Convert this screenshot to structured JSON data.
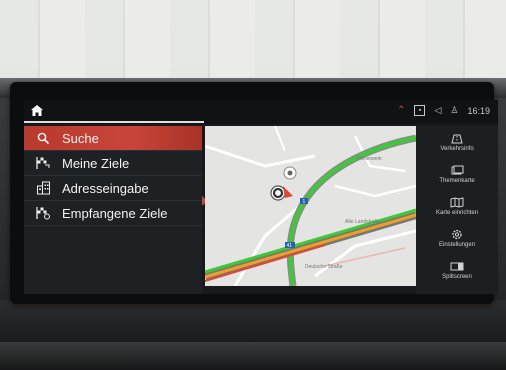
{
  "statusbar": {
    "time": "16:19",
    "icons": [
      "up-arrow-icon",
      "device-icon",
      "volume-icon",
      "person-icon"
    ]
  },
  "menu": {
    "items": [
      {
        "label": "Suche",
        "icon": "search-icon",
        "active": true
      },
      {
        "label": "Meine Ziele",
        "icon": "flag-icon",
        "active": false
      },
      {
        "label": "Adresseingabe",
        "icon": "building-icon",
        "active": false
      },
      {
        "label": "Empfangene Ziele",
        "icon": "received-flag-icon",
        "active": false
      }
    ]
  },
  "side": {
    "items": [
      {
        "label": "Verkehrsinfo",
        "icon": "traffic-icon"
      },
      {
        "label": "Themenkarte",
        "icon": "map-layers-icon"
      },
      {
        "label": "Karte einrichten",
        "icon": "map-settings-icon"
      },
      {
        "label": "Einstellungen",
        "icon": "gear-icon"
      },
      {
        "label": "Splitscreen",
        "icon": "splitscreen-icon"
      }
    ]
  },
  "map": {
    "route_badge_1": "1",
    "route_badge_2": "41",
    "street_1": "Pfeilerwerk",
    "street_2": "Alte Landstraße",
    "street_3": "Deutsche Straße"
  },
  "colors": {
    "accent": "#c8453a",
    "traffic_green": "#3fc93a",
    "traffic_orange": "#f0a020",
    "traffic_red": "#e0453a"
  }
}
